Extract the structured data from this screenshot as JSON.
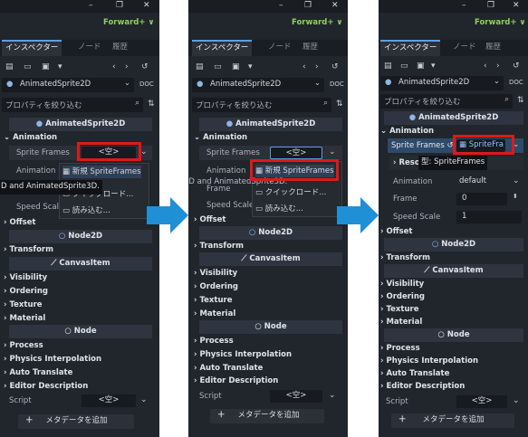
{
  "window_controls": {
    "minimize": "–",
    "restore": "❐",
    "close": "✕"
  },
  "renderer": "Forward+ ∨",
  "tabs": {
    "inspector": "インスペクター",
    "node": "ノード",
    "history": "履歴"
  },
  "object": {
    "name": "AnimatedSprite2D"
  },
  "filter_placeholder": "プロパティを絞り込む",
  "headers": {
    "animated_sprite": "AnimatedSprite2D",
    "node2d": "Node2D",
    "canvas_item": "CanvasItem",
    "node": "Node"
  },
  "props": {
    "animation_section": "Animation",
    "sprite_frames": "Sprite Frames",
    "empty_value": "<空>",
    "animation": "Animation",
    "frame": "Frame",
    "speed_scale": "Speed Scale",
    "offset": "Offset",
    "transform": "Transform",
    "visibility": "Visibility",
    "ordering": "Ordering",
    "texture": "Texture",
    "material": "Material",
    "process": "Process",
    "physics_interpolation": "Physics Interpolation",
    "auto_translate": "Auto Translate",
    "editor_description": "Editor Description",
    "script": "Script"
  },
  "menu": {
    "new_sprite_frames": "新規 SpriteFrames",
    "quickload": "クイックロード...",
    "load": "読み込む..."
  },
  "tooltip_panel1": "D and AnimatedSprite3D.",
  "tooltip_panel2": "2D and AnimatedSprite3D.",
  "panel3": {
    "sprite_frames_value": "SpriteFra",
    "resource": "Resou",
    "type_tooltip": "型: SpriteFrames",
    "animation_value": "default",
    "frame_value": "0",
    "speed_scale_value": "1"
  },
  "add_metadata": "メタデータを追加",
  "colors": {
    "accent": "#5e9fe0",
    "highlight": "#e01818",
    "arrow": "#1f8fd6",
    "renderer": "#8fd15f"
  }
}
